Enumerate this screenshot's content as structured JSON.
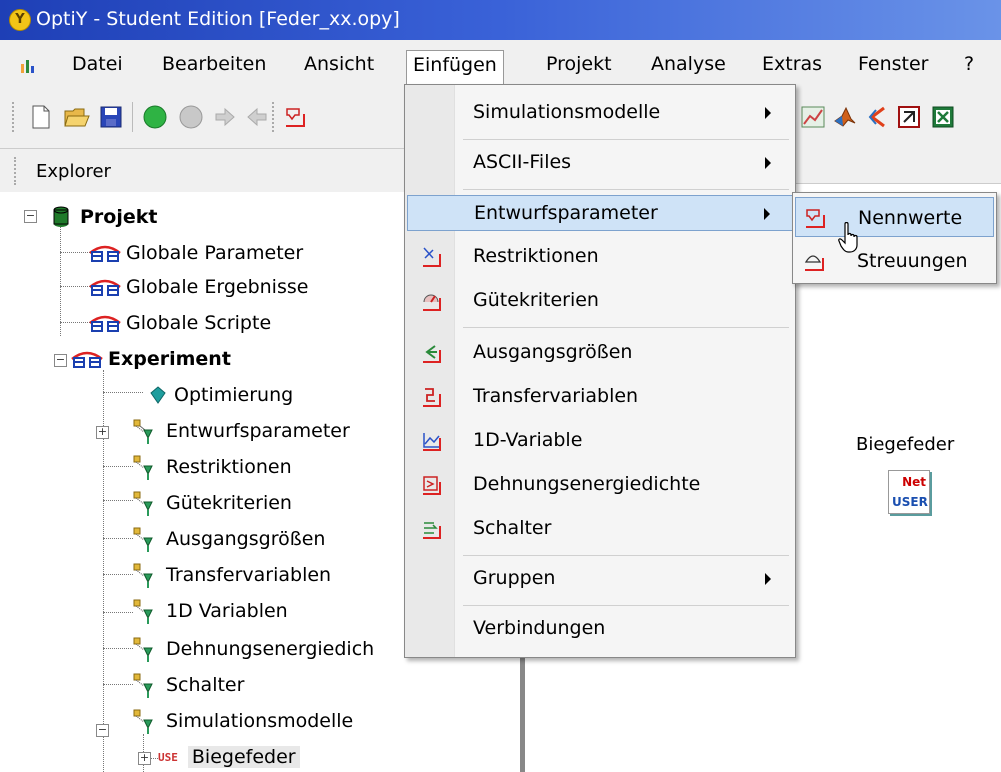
{
  "window": {
    "title": "OptiY - Student Edition [Feder_xx.opy]",
    "app_icon_letter": "Y"
  },
  "menubar": {
    "items": [
      "Datei",
      "Bearbeiten",
      "Ansicht",
      "Einfügen",
      "Projekt",
      "Analyse",
      "Extras",
      "Fenster",
      "?"
    ],
    "active": "Einfügen"
  },
  "explorer": {
    "label": "Explorer"
  },
  "tree": {
    "root": "Projekt",
    "items": [
      "Globale Parameter",
      "Globale Ergebnisse",
      "Globale Scripte",
      "Experiment",
      "Optimierung",
      "Entwurfsparameter",
      "Restriktionen",
      "Gütekriterien",
      "Ausgangsgrößen",
      "Transfervariablen",
      "1D Variablen",
      "Dehnungsenergiedich",
      "Schalter",
      "Simulationsmodelle",
      "Biegefeder"
    ],
    "biegefeder_prefix": "USE"
  },
  "dropdown": {
    "items": [
      "Simulationsmodelle",
      "ASCII-Files",
      "Entwurfsparameter",
      "Restriktionen",
      "Gütekriterien",
      "Ausgangsgrößen",
      "Transfervariablen",
      "1D-Variable",
      "Dehnungsenergiedichte",
      "Schalter",
      "Gruppen",
      "Verbindungen"
    ],
    "highlighted": "Entwurfsparameter"
  },
  "submenu": {
    "items": [
      "Nennwerte",
      "Streuungen"
    ],
    "highlighted": "Nennwerte"
  },
  "canvas": {
    "node_label": "Biegefeder",
    "node_icon_top": "Net",
    "node_icon_bottom": "USER"
  },
  "colors": {
    "titlebar": "#2a50c8",
    "menu_highlight": "#cfe3f7",
    "menu_highlight_border": "#7da2ce",
    "icon_red": "#d22",
    "tree_icon_blue": "#1a3fb0",
    "tree_icon_red": "#d22"
  }
}
